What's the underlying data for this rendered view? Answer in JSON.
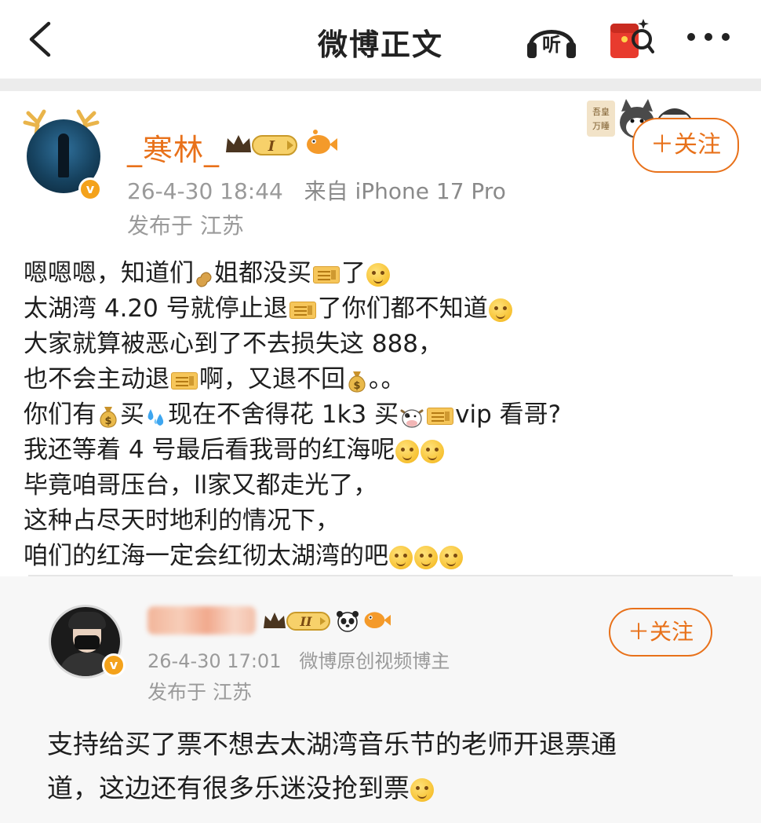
{
  "nav": {
    "title": "微博正文",
    "back_icon": "back-arrow-icon",
    "listen_label": "听",
    "redpacket_icon": "red-packet-search-icon",
    "more_icon": "more-dots-icon"
  },
  "post": {
    "username": "_寒林_",
    "vip_level": "I",
    "date": "26-4-30 18:44",
    "source": "来自 iPhone 17 Pro",
    "location": "发布于 江苏",
    "follow_label": "＋关注",
    "lines": [
      [
        "嗯嗯嗯，知道们",
        {
          "emo": "peanut"
        },
        "姐都没买",
        {
          "emo": "ticket"
        },
        "了",
        {
          "emo": "face"
        }
      ],
      [
        "太湖湾 4.20 号就停止退",
        {
          "emo": "ticket"
        },
        "了你们都不知道",
        {
          "emo": "face"
        }
      ],
      [
        "大家就算被恶心到了不去损失这 888，"
      ],
      [
        "也不会主动退",
        {
          "emo": "ticket"
        },
        "啊，又退不回",
        {
          "emo": "bag"
        },
        "。。"
      ],
      [
        "你们有",
        {
          "emo": "bag"
        },
        "买",
        {
          "emo": "drops"
        },
        "现在不舍得花 1k3 买",
        {
          "emo": "cow"
        },
        {
          "emo": "ticket"
        },
        "vip 看哥?"
      ],
      [
        "我还等着 4 号最后看我哥的红海呢",
        {
          "emo": "face"
        },
        {
          "emo": "face"
        }
      ],
      [
        "毕竟咱哥压台，ll家又都走光了，"
      ],
      [
        "这种占尽天时地利的情况下，"
      ],
      [
        "咱们的红海一定会红彻太湖湾的吧",
        {
          "emo": "face"
        },
        {
          "emo": "face"
        },
        {
          "emo": "face"
        }
      ]
    ]
  },
  "quote": {
    "vip_level": "II",
    "date": "26-4-30 17:01",
    "role": "微博原创视频博主",
    "location": "发布于 江苏",
    "follow_label": "＋关注",
    "lines": [
      [
        "支持给买了票不想去太湖湾音乐节的老师开退票通"
      ],
      [
        "道，这边还有很多乐迷没抢到票",
        {
          "emo": "face"
        }
      ]
    ]
  },
  "colors": {
    "accent": "#e8711a",
    "meta_gray": "#9a9a9a",
    "quote_bg": "#f7f7f7"
  }
}
